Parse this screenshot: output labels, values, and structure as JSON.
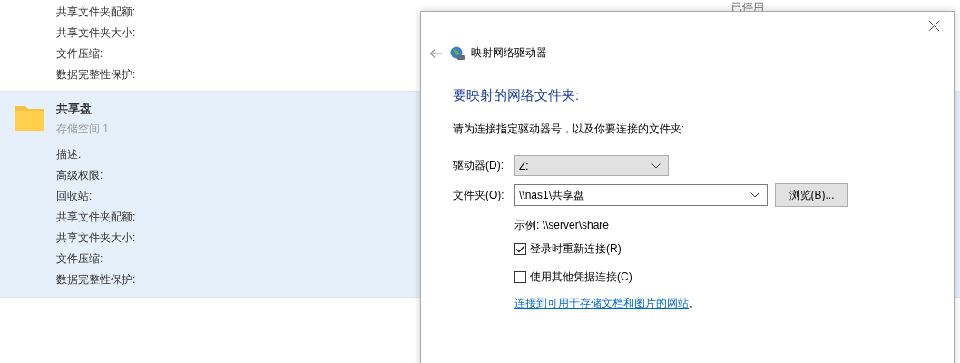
{
  "background": {
    "status": "已停用",
    "top_fields": [
      "共享文件夹配额:",
      "共享文件夹大小:",
      "文件压缩:",
      "数据完整性保护:"
    ],
    "share": {
      "name": "共享盘",
      "subtitle": "存储空间 1",
      "selected": true,
      "fields": [
        "描述:",
        "高级权限:",
        "回收站:",
        "共享文件夹配额:",
        "共享文件夹大小:",
        "文件压缩:",
        "数据完整性保护:"
      ]
    }
  },
  "dialog": {
    "title": "映射网络驱动器",
    "heading": "要映射的网络文件夹:",
    "instruction": "请为连接指定驱动器号，以及你要连接的文件夹:",
    "drive": {
      "label": "驱动器(D):",
      "value": "Z:"
    },
    "folder": {
      "label": "文件夹(O):",
      "value": "\\\\nas1\\共享盘"
    },
    "browse_button": "浏览(B)...",
    "example": "示例: \\\\server\\share",
    "options": [
      {
        "label": "登录时重新连接(R)",
        "checked": true
      },
      {
        "label": "使用其他凭据连接(C)",
        "checked": false
      }
    ],
    "link": "连接到可用于存储文档和图片的网站",
    "link_suffix": "。"
  }
}
